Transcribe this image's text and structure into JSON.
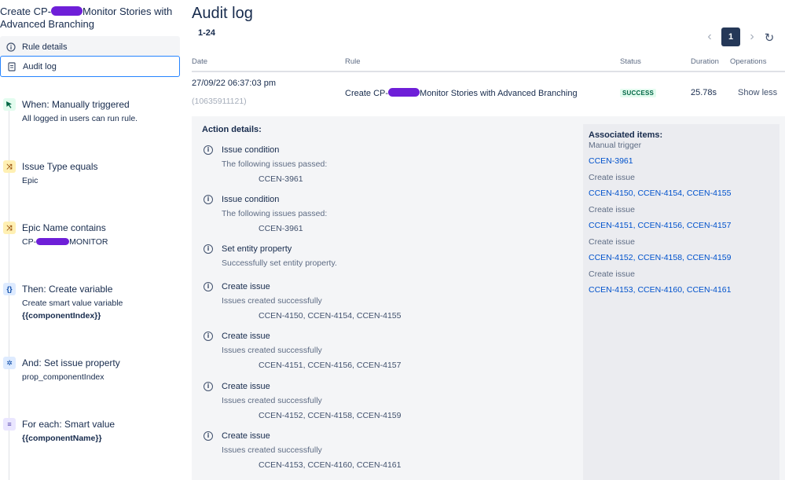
{
  "sidebar": {
    "rule_title_part1": "Create CP-",
    "rule_title_part2": "Monitor Stories with",
    "rule_title_line2": "Advanced Branching",
    "nav": {
      "rule_details": "Rule details",
      "audit_log": "Audit log"
    },
    "components": [
      {
        "icon": "cursor-click-icon",
        "title": "When: Manually triggered",
        "desc": "All logged in users can run rule.",
        "value": ""
      },
      {
        "icon": "shuffle-icon",
        "title": "Issue Type equals",
        "desc": "Epic",
        "value": ""
      },
      {
        "icon": "shuffle-icon",
        "title": "Epic Name contains",
        "desc_part1": "CP-",
        "desc_part2": "MONITOR",
        "value": ""
      },
      {
        "icon": "braces-icon",
        "title": "Then: Create variable",
        "desc": "Create smart value variable",
        "value": "{{componentIndex}}"
      },
      {
        "icon": "gear-icon",
        "title": "And: Set issue property",
        "desc": "prop_componentIndex",
        "value": ""
      },
      {
        "icon": "list-icon",
        "title": "For each: Smart value",
        "desc": "",
        "value": "{{componentName}}"
      }
    ]
  },
  "main": {
    "title": "Audit log",
    "range": "1-24",
    "pager": {
      "current": "1",
      "prev": "‹",
      "next": "›"
    },
    "refresh": "↻",
    "columns": {
      "date": "Date",
      "rule": "Rule",
      "status": "Status",
      "duration": "Duration",
      "operations": "Operations"
    },
    "row": {
      "date": "27/09/22 06:37:03 pm",
      "id": "(10635911121)",
      "rule_part1": "Create CP-",
      "rule_part2": "Monitor Stories with Advanced Branching",
      "status": "SUCCESS",
      "duration": "25.78s",
      "operation": "Show less"
    },
    "details": {
      "heading": "Action details:",
      "actions": [
        {
          "name": "Issue condition",
          "message": "The following issues passed:",
          "keys": "CCEN-3961"
        },
        {
          "name": "Issue condition",
          "message": "The following issues passed:",
          "keys": "CCEN-3961"
        },
        {
          "name": "Set entity property",
          "message": "Successfully set entity property.",
          "keys": ""
        },
        {
          "name": "Create issue",
          "message": "Issues created successfully",
          "keys": "CCEN-4150, CCEN-4154, CCEN-4155"
        },
        {
          "name": "Create issue",
          "message": "Issues created successfully",
          "keys": "CCEN-4151, CCEN-4156, CCEN-4157"
        },
        {
          "name": "Create issue",
          "message": "Issues created successfully",
          "keys": "CCEN-4152, CCEN-4158, CCEN-4159"
        },
        {
          "name": "Create issue",
          "message": "Issues created successfully",
          "keys": "CCEN-4153, CCEN-4160, CCEN-4161"
        }
      ],
      "associated": {
        "heading": "Associated items:",
        "groups": [
          {
            "label": "Manual trigger",
            "links": "CCEN-3961"
          },
          {
            "label": "Create issue",
            "links": "CCEN-4150, CCEN-4154, CCEN-4155"
          },
          {
            "label": "Create issue",
            "links": "CCEN-4151, CCEN-4156, CCEN-4157"
          },
          {
            "label": "Create issue",
            "links": "CCEN-4152, CCEN-4158, CCEN-4159"
          },
          {
            "label": "Create issue",
            "links": "CCEN-4153, CCEN-4160, CCEN-4161"
          }
        ]
      }
    }
  }
}
